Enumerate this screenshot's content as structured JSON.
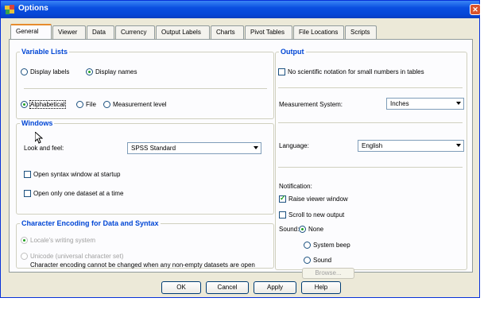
{
  "window": {
    "title": "Options",
    "close_symbol": "✕"
  },
  "tabs": [
    {
      "label": "General",
      "active": true
    },
    {
      "label": "Viewer"
    },
    {
      "label": "Data"
    },
    {
      "label": "Currency"
    },
    {
      "label": "Output Labels"
    },
    {
      "label": "Charts"
    },
    {
      "label": "Pivot Tables"
    },
    {
      "label": "File Locations"
    },
    {
      "label": "Scripts"
    }
  ],
  "variable_lists": {
    "legend": "Variable Lists",
    "display_labels": "Display labels",
    "display_names": "Display names",
    "alphabetical": "Alphabetical",
    "file": "File",
    "measurement_level": "Measurement level"
  },
  "windows": {
    "legend": "Windows",
    "look_and_feel_label": "Look and feel:",
    "look_and_feel_value": "SPSS Standard",
    "open_syntax": "Open syntax window at startup",
    "open_one_dataset": "Open only one dataset at a time"
  },
  "encoding": {
    "legend": "Character Encoding for Data and Syntax",
    "locale": "Locale's writing system",
    "unicode": "Unicode (universal character set)",
    "note": "Character encoding cannot be changed when any non-empty datasets are open"
  },
  "output": {
    "legend": "Output",
    "no_scientific": "No scientific notation for small numbers in tables",
    "measurement_label": "Measurement System:",
    "measurement_value": "Inches",
    "language_label": "Language:",
    "language_value": "English",
    "notification_label": "Notification:",
    "raise_viewer": "Raise viewer window",
    "scroll_output": "Scroll to new output",
    "sound_label": "Sound:",
    "sound_none": "None",
    "sound_system_beep": "System beep",
    "sound_sound": "Sound",
    "browse": "Browse..."
  },
  "buttons": {
    "ok": "OK",
    "cancel": "Cancel",
    "apply": "Apply",
    "help": "Help"
  },
  "colors": {
    "title_bar": "#0a4fe0",
    "group_legend": "#0046d5",
    "active_tab_accent": "#e68b2c"
  },
  "icons": {
    "app_icon": "spss-options-icon",
    "close": "close-icon",
    "cursor": "mouse-pointer-icon"
  }
}
